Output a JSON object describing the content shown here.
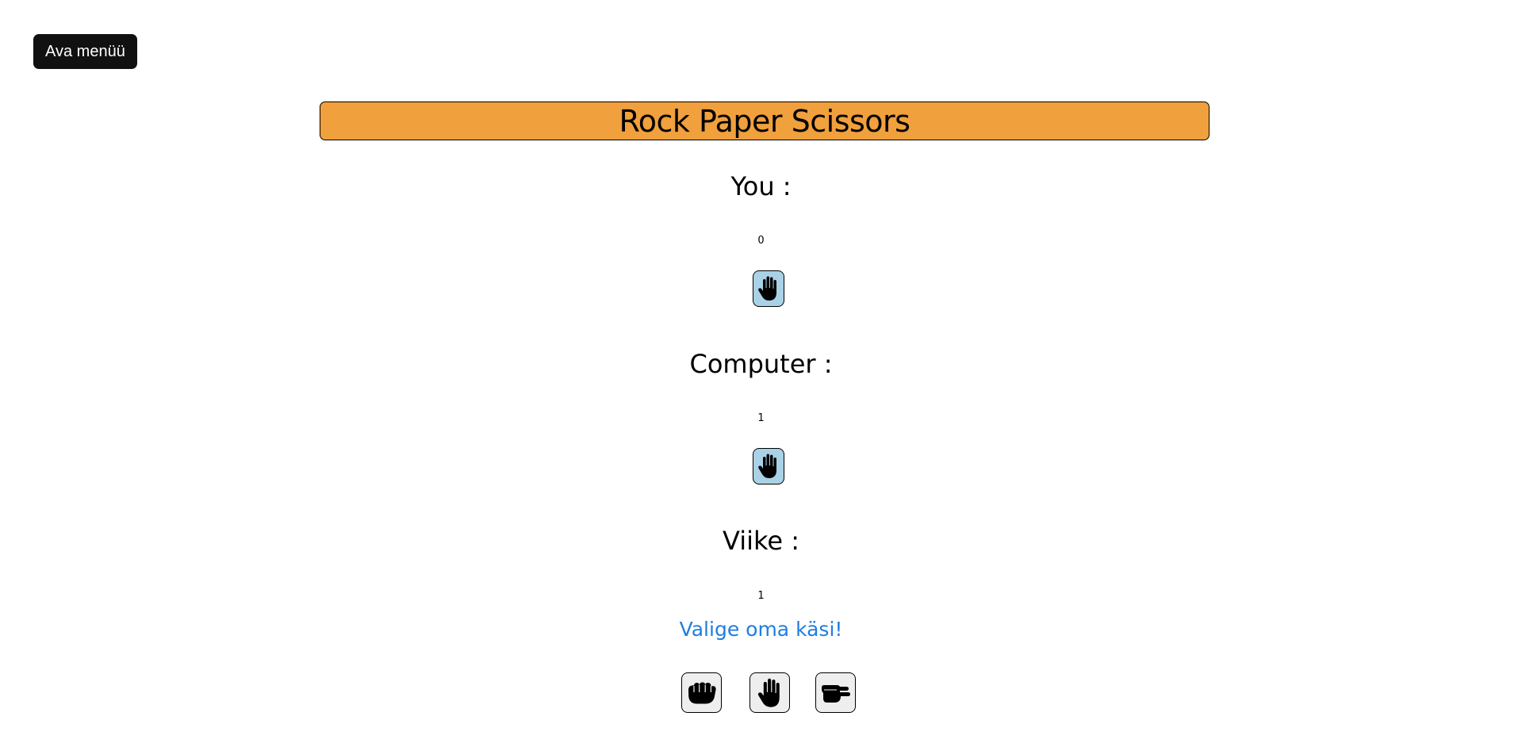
{
  "menu": {
    "open_label": "Ava menüü"
  },
  "title": "Rock Paper Scissors",
  "player": {
    "label": "You :",
    "score": "0",
    "hand_icon": "paper-hand-icon"
  },
  "computer": {
    "label": "Computer :",
    "score": "1",
    "hand_icon": "paper-hand-icon"
  },
  "tie": {
    "label": "Viike :",
    "score": "1"
  },
  "prompt": "Valige oma käsi!",
  "choices": [
    {
      "name": "rock",
      "icon": "rock-hand-icon"
    },
    {
      "name": "paper",
      "icon": "paper-hand-icon"
    },
    {
      "name": "scissors",
      "icon": "scissors-hand-icon"
    }
  ],
  "colors": {
    "title_bg": "#f0a03c",
    "display_hand_bg": "#a9d2e6",
    "choice_bg": "#eeeeee",
    "prompt": "#1c7fe0",
    "menu_button_bg": "#111111"
  }
}
